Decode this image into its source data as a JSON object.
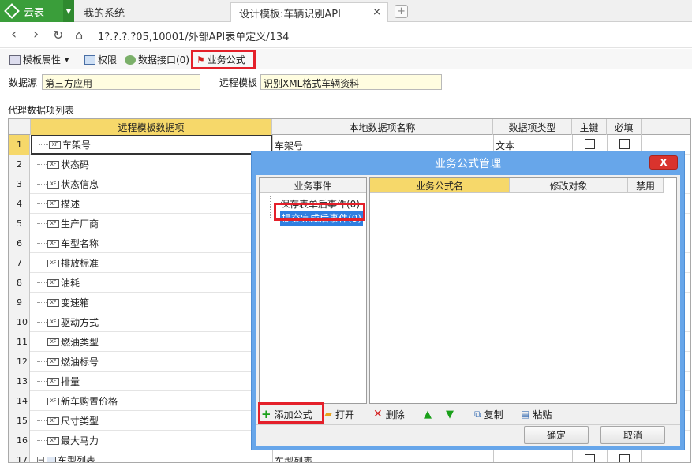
{
  "browser": {
    "app_name": "云表",
    "tabs": [
      {
        "label": "我的系统"
      },
      {
        "label": "设计模板:车辆识别API",
        "close": "×"
      }
    ],
    "new_tab_symbol": "+",
    "url": "1?.?.?.?05,10001/外部API表单定义/134"
  },
  "toolbar": {
    "items": [
      {
        "label": "模板属性",
        "icon": "template-props-icon"
      },
      {
        "label": "权限",
        "icon": "permission-icon"
      },
      {
        "label": "数据接口(0)",
        "icon": "data-interface-icon"
      },
      {
        "label": "业务公式",
        "icon": "business-formula-icon"
      }
    ],
    "highlight_color": "#e4202a"
  },
  "form": {
    "datasource_label": "数据源",
    "datasource_value": "第三方应用",
    "remote_template_label": "远程模板",
    "remote_template_value": "识别XML格式车辆资料"
  },
  "grid": {
    "title": "代理数据项列表",
    "columns": [
      "远程模板数据项",
      "本地数据项名称",
      "数据项类型",
      "主键",
      "必填"
    ],
    "rows": [
      {
        "n": "1",
        "name": "车架号",
        "local": "车架号",
        "type": "文本"
      },
      {
        "n": "2",
        "name": "状态码"
      },
      {
        "n": "3",
        "name": "状态信息"
      },
      {
        "n": "4",
        "name": "描述"
      },
      {
        "n": "5",
        "name": "生产厂商"
      },
      {
        "n": "6",
        "name": "车型名称"
      },
      {
        "n": "7",
        "name": "排放标准"
      },
      {
        "n": "8",
        "name": "油耗"
      },
      {
        "n": "9",
        "name": "变速箱"
      },
      {
        "n": "10",
        "name": "驱动方式"
      },
      {
        "n": "11",
        "name": "燃油类型"
      },
      {
        "n": "12",
        "name": "燃油标号"
      },
      {
        "n": "13",
        "name": "排量"
      },
      {
        "n": "14",
        "name": "新车购置价格"
      },
      {
        "n": "15",
        "name": "尺寸类型"
      },
      {
        "n": "16",
        "name": "最大马力"
      },
      {
        "n": "17",
        "name": "车型列表",
        "local": "车型列表"
      }
    ],
    "field_tag": "XF"
  },
  "dialog": {
    "title": "业务公式管理",
    "close_label": "X",
    "events_header": "业务事件",
    "events": [
      {
        "label": "保存表单后事件(0)"
      },
      {
        "label": "提交完成后事件(0)"
      }
    ],
    "formula_columns": [
      "业务公式名",
      "修改对象",
      "禁用"
    ],
    "actions": [
      {
        "label": "添加公式",
        "icon": "+"
      },
      {
        "label": "打开",
        "icon": "▰"
      },
      {
        "label": "删除",
        "icon": "✕"
      },
      {
        "label": "",
        "icon": "▲"
      },
      {
        "label": "",
        "icon": "▼"
      },
      {
        "label": "复制",
        "icon": "⧉"
      },
      {
        "label": "粘贴",
        "icon": "▤"
      }
    ],
    "ok_label": "确定",
    "cancel_label": "取消"
  }
}
